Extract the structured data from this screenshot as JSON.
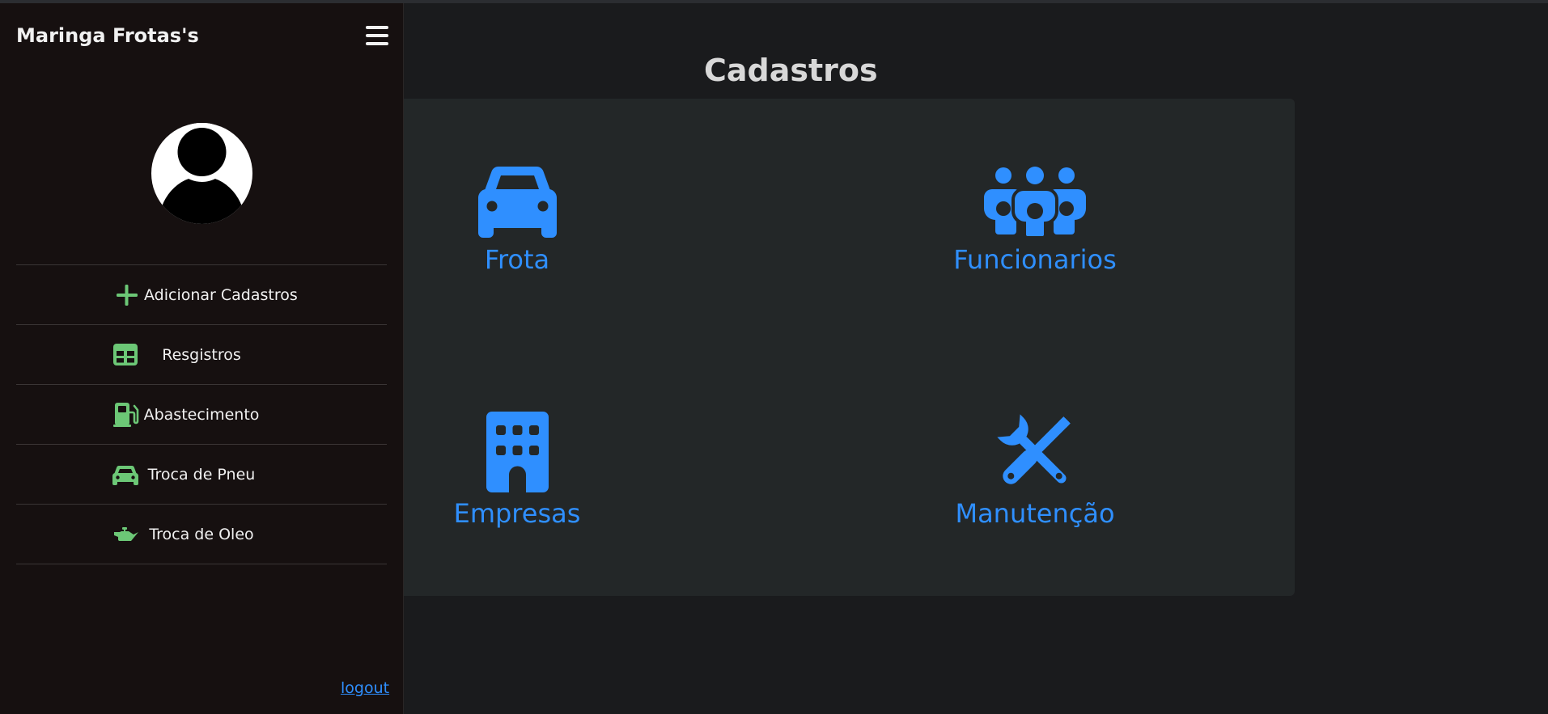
{
  "sidebar": {
    "brand": "Maringa Frotas's",
    "menu": [
      {
        "label": "Adicionar Cadastros",
        "icon": "plus-icon"
      },
      {
        "label": "Resgistros",
        "icon": "table-icon"
      },
      {
        "label": "Abastecimento",
        "icon": "gas-pump-icon"
      },
      {
        "label": "Troca de Pneu",
        "icon": "car-icon"
      },
      {
        "label": "Troca de Oleo",
        "icon": "oil-can-icon"
      }
    ],
    "logout": "logout"
  },
  "main": {
    "title": "Cadastros",
    "cards": [
      {
        "label": "Frota",
        "icon": "car-icon"
      },
      {
        "label": "Funcionarios",
        "icon": "people-group-icon"
      },
      {
        "label": "Empresas",
        "icon": "building-icon"
      },
      {
        "label": "Manutenção",
        "icon": "screwdriver-wrench-icon"
      }
    ]
  },
  "colors": {
    "accent_blue": "#2f8fff",
    "menu_icon_green": "#6cc776",
    "sidebar_bg": "#161010",
    "panel_bg": "#232728",
    "page_bg": "#1a1b1d"
  }
}
